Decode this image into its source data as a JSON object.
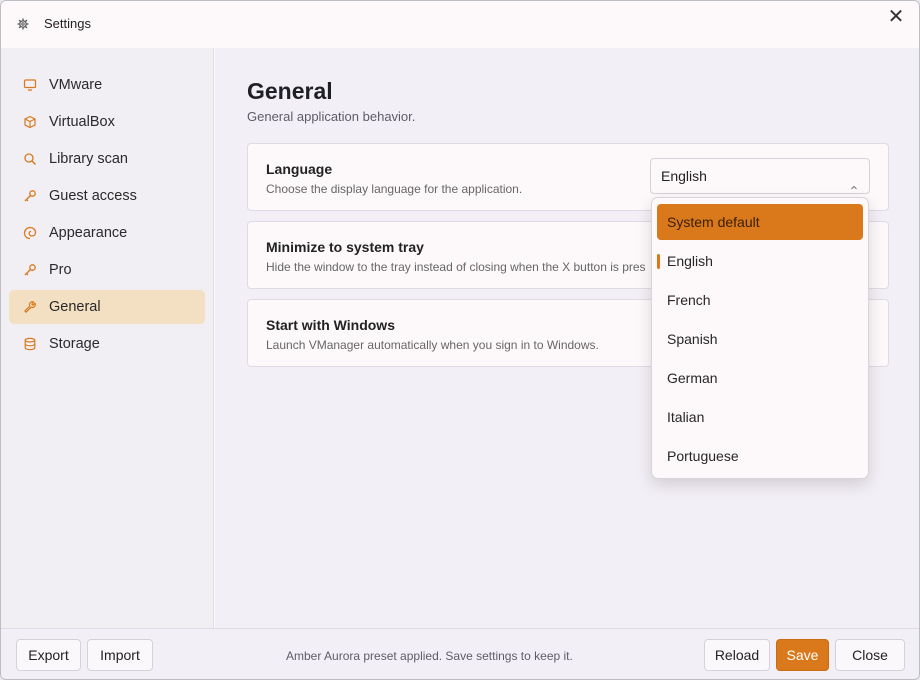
{
  "window": {
    "title": "Settings",
    "close_symbol": "✕"
  },
  "sidebar": {
    "items": [
      {
        "label": "VMware",
        "icon": "monitor-icon"
      },
      {
        "label": "VirtualBox",
        "icon": "cube-icon"
      },
      {
        "label": "Library scan",
        "icon": "search-icon"
      },
      {
        "label": "Guest access",
        "icon": "key-icon"
      },
      {
        "label": "Appearance",
        "icon": "swirl-icon"
      },
      {
        "label": "Pro",
        "icon": "key-icon"
      },
      {
        "label": "General",
        "icon": "wrench-icon",
        "active": true
      },
      {
        "label": "Storage",
        "icon": "database-icon"
      }
    ]
  },
  "main": {
    "title": "General",
    "subtitle": "General application behavior.",
    "cards": [
      {
        "title": "Language",
        "description": "Choose the display language for the application.",
        "select_value": "English"
      },
      {
        "title": "Minimize to system tray",
        "description": "Hide the window to the tray instead of closing when the X button is pres"
      },
      {
        "title": "Start with Windows",
        "description": "Launch VManager automatically when you sign in to Windows."
      }
    ]
  },
  "dropdown": {
    "options": [
      "System default",
      "English",
      "French",
      "Spanish",
      "German",
      "Italian",
      "Portuguese"
    ],
    "highlighted": "System default",
    "selected": "English"
  },
  "footer": {
    "export_label": "Export",
    "import_label": "Import",
    "status_text": "Amber Aurora preset applied. Save settings to keep it.",
    "reload_label": "Reload",
    "save_label": "Save",
    "close_label": "Close"
  },
  "colors": {
    "accent": "#d9791b",
    "active_nav_bg": "#f3dfc2",
    "sidebar_bg": "#f1eef4"
  }
}
